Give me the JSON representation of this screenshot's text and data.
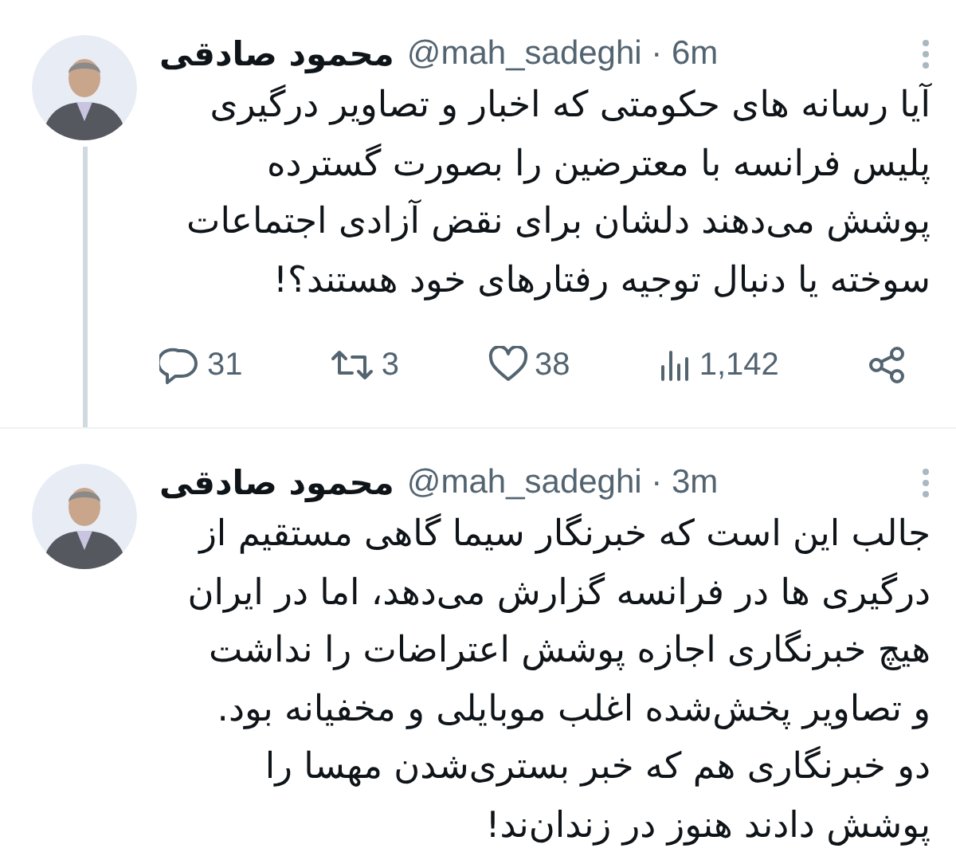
{
  "tweets": [
    {
      "name": "محمود صادقی",
      "handle": "@mah_sadeghi · 6m",
      "lines": [
        "آیا رسانه های حکومتی که اخبار و تصاویر درگیری",
        "پلیس فرانسه با معترضین را بصورت گسترده",
        "پوشش می‌دهند دلشان برای نقض آزادی اجتماعات",
        "سوخته یا دنبال توجیه رفتارهای خود هستند؟!"
      ],
      "actions": [
        {
          "kind": "share"
        },
        {
          "kind": "views",
          "count": "1,142"
        },
        {
          "kind": "like",
          "count": "38"
        },
        {
          "kind": "retweet",
          "count": "3"
        },
        {
          "kind": "reply",
          "count": "31"
        }
      ]
    },
    {
      "name": "محمود صادقی",
      "handle": "@mah_sadeghi · 3m",
      "lines": [
        "جالب این است که خبرنگار سیما گاهی مستقیم از",
        "درگیری ها در فرانسه گزارش می‌دهد، اما در ایران",
        "هیچ خبرنگاری اجازه پوشش اعتراضات را نداشت",
        "و تصاویر پخش‌شده اغلب موبایلی و مخفیانه بود.",
        "دو خبرنگاری هم که خبر بستری‌شدن مهسا را",
        "پوشش دادند هنوز در زندان‌ند!"
      ]
    }
  ]
}
